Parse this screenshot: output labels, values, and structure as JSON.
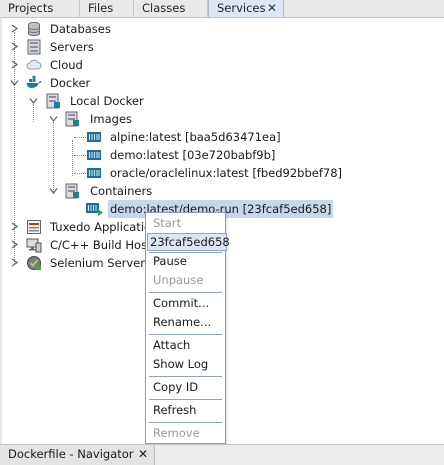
{
  "tabs": [
    {
      "label": "Projects"
    },
    {
      "label": "Files"
    },
    {
      "label": "Classes"
    },
    {
      "label": "Services",
      "close": "✕"
    }
  ],
  "tree": {
    "databases": "Databases",
    "servers": "Servers",
    "cloud": "Cloud",
    "docker": "Docker",
    "local_docker": "Local Docker",
    "images": "Images",
    "image_items": [
      "alpine:latest [baa5d63471ea]",
      "demo:latest [03e720babf9b]",
      "oracle/oraclelinux:latest [fbed92bbef78]"
    ],
    "containers": "Containers",
    "container_item": "demo:latest/demo-run [23fcaf5ed658]",
    "tuxedo": "Tuxedo Application",
    "cpp_build": "C/C++ Build Hosts",
    "selenium": "Selenium Server"
  },
  "context_menu": {
    "start": "Start",
    "id": "23fcaf5ed658",
    "pause": "Pause",
    "unpause": "Unpause",
    "commit": "Commit...",
    "rename": "Rename...",
    "attach": "Attach",
    "show_log": "Show Log",
    "copy_id": "Copy ID",
    "refresh": "Refresh",
    "remove": "Remove"
  },
  "bottom_panel": {
    "tab_label": "Dockerfile - Navigator",
    "close": "✕"
  },
  "colors": {
    "selection": "#c6d7ea",
    "docker_blue": "#1f7ba3",
    "menu_highlight": "#dbe6f2"
  }
}
